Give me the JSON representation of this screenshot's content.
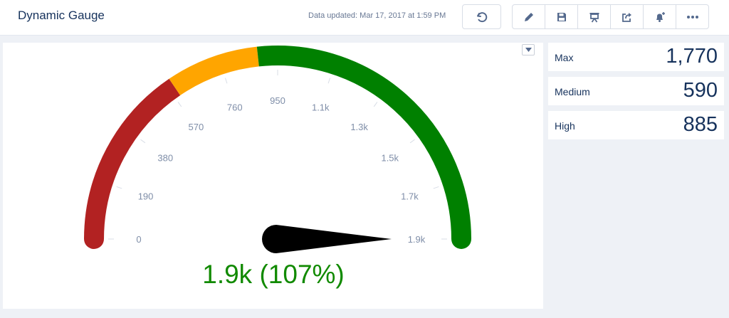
{
  "header": {
    "title": "Dynamic Gauge",
    "updated": "Data updated: Mar 17, 2017 at 1:59 PM"
  },
  "toolbar": {
    "buttons": [
      {
        "icon": "undo-icon"
      },
      {
        "icon": "pencil-icon"
      },
      {
        "icon": "save-icon"
      },
      {
        "icon": "presentation-icon"
      },
      {
        "icon": "share-icon"
      },
      {
        "icon": "bell-plus-icon"
      },
      {
        "icon": "more-icon"
      }
    ]
  },
  "gauge": {
    "value_label": "1.9k (107%)",
    "colors": {
      "red": "#b22222",
      "orange": "#ffa500",
      "green": "#008000",
      "needle": "#000000",
      "value_text": "#118a00"
    }
  },
  "stats": [
    {
      "label": "Max",
      "value": "1,770"
    },
    {
      "label": "Medium",
      "value": "590"
    },
    {
      "label": "High",
      "value": "885"
    }
  ],
  "chart_data": {
    "type": "gauge",
    "min": 0,
    "max": 1900,
    "value": 1900,
    "percent_of_max": 107,
    "ticks": [
      "0",
      "190",
      "380",
      "570",
      "760",
      "950",
      "1.1k",
      "1.3k",
      "1.5k",
      "1.7k",
      "1.9k"
    ],
    "bands": [
      {
        "from": 0,
        "to": 590,
        "color": "#b22222"
      },
      {
        "from": 590,
        "to": 885,
        "color": "#ffa500"
      },
      {
        "from": 885,
        "to": 1900,
        "color": "#008000"
      }
    ],
    "value_label": "1.9k (107%)"
  }
}
